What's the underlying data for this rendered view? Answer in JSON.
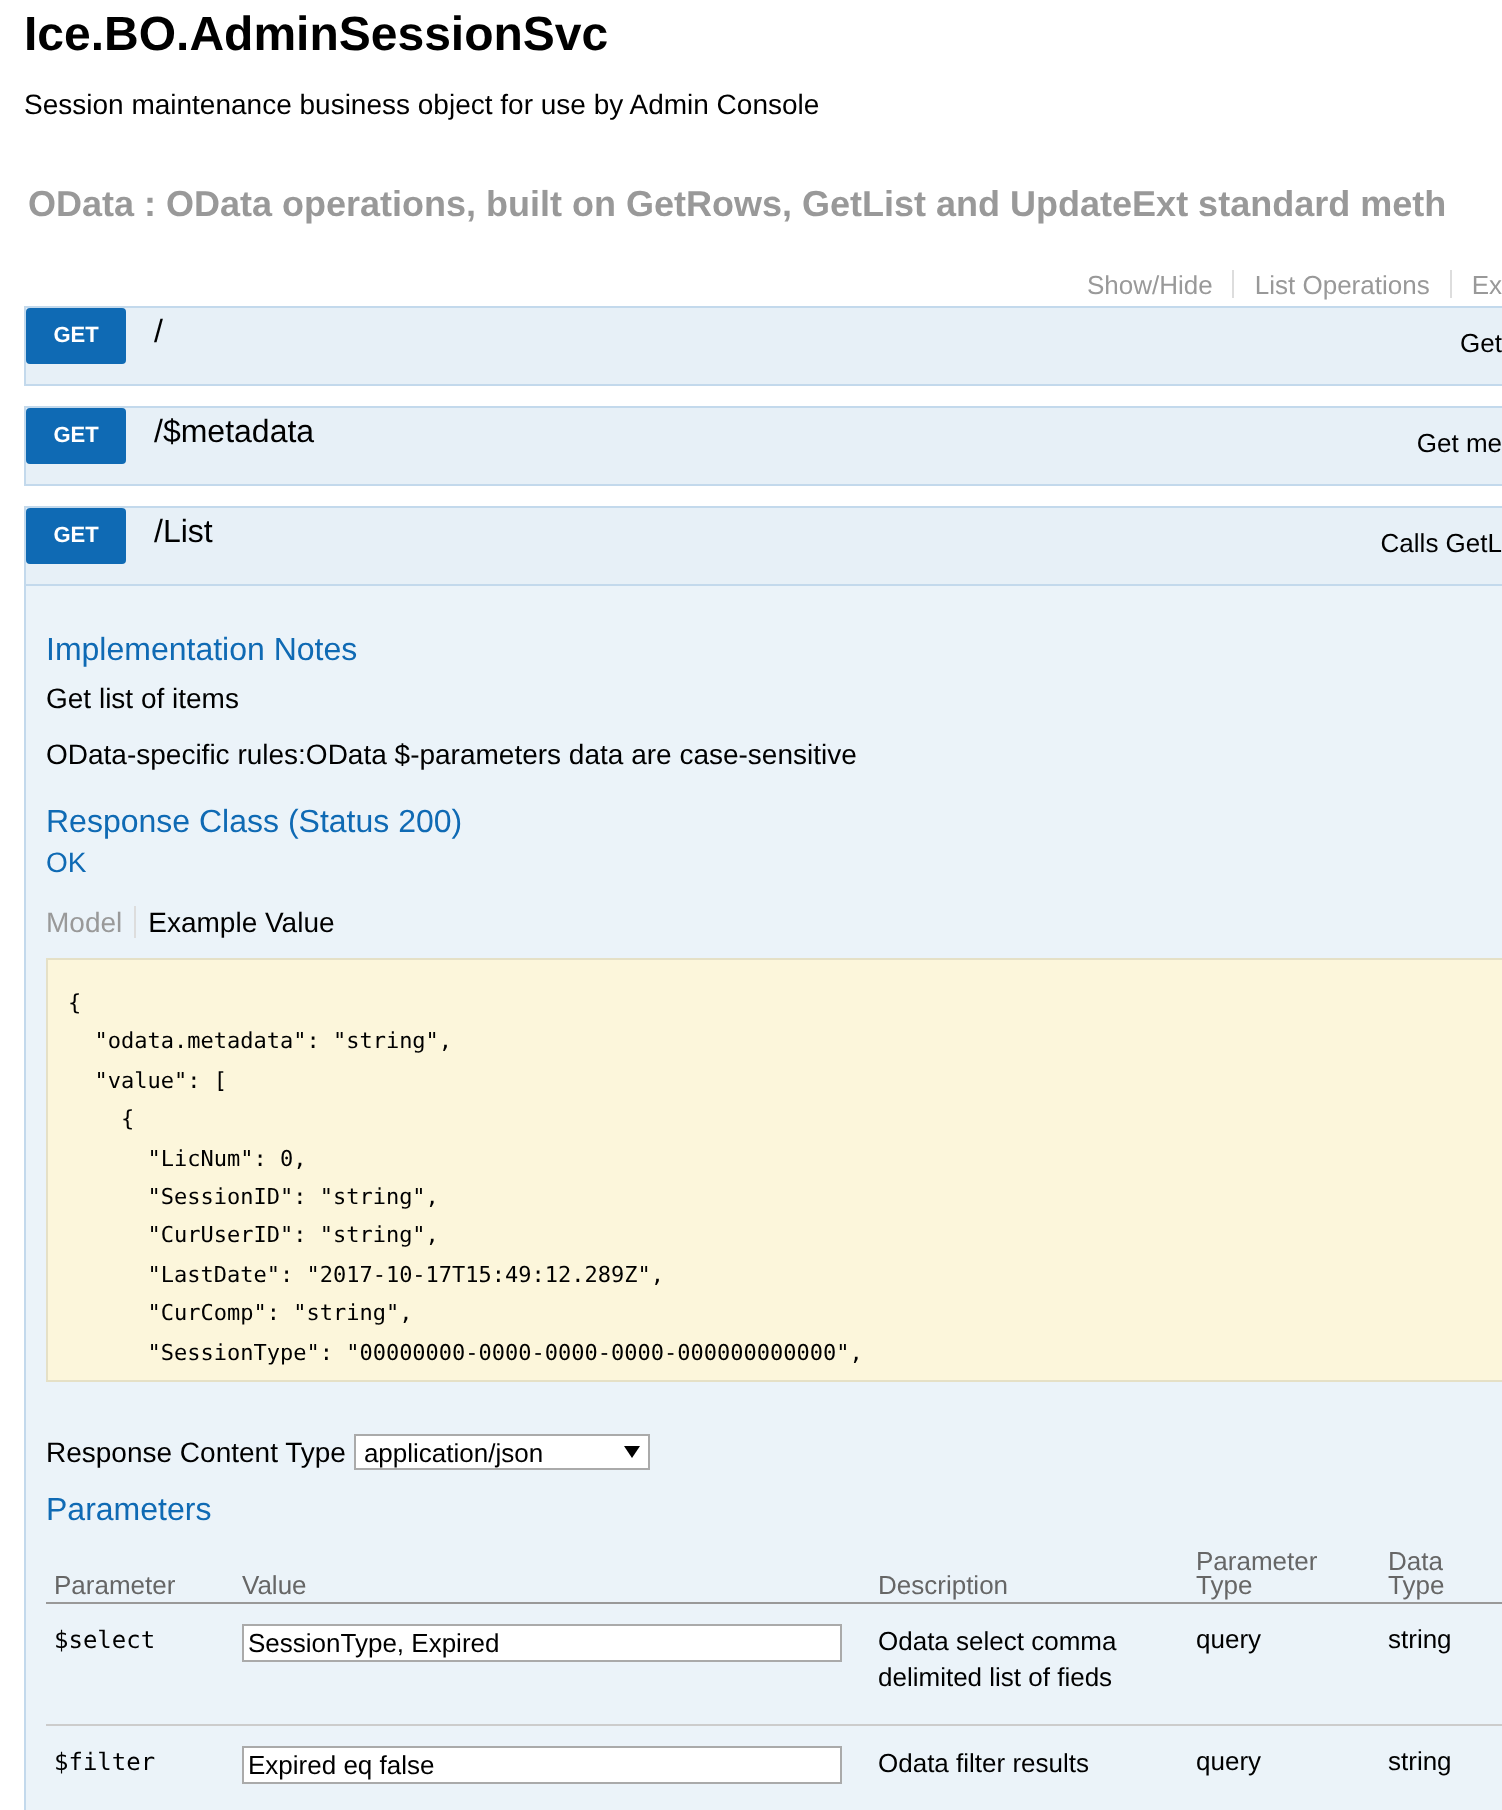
{
  "title": "Ice.BO.AdminSessionSvc",
  "description": "Session maintenance business object for use by Admin Console",
  "section": {
    "heading": "OData : OData operations, built on GetRows, GetList and UpdateExt standard meth",
    "links": [
      "Show/Hide",
      "List Operations",
      "Ex"
    ]
  },
  "operations": [
    {
      "method": "GET",
      "path": "/",
      "summary": "Get",
      "expanded": false
    },
    {
      "method": "GET",
      "path": "/$metadata",
      "summary": "Get me",
      "expanded": false
    },
    {
      "method": "GET",
      "path": "/List",
      "summary": "Calls GetL",
      "expanded": true
    }
  ],
  "details": {
    "implementation_notes_heading": "Implementation Notes",
    "notes": [
      "Get list of items",
      "OData-specific rules:OData $-parameters data are case-sensitive"
    ],
    "response_class_heading": "Response Class (Status 200)",
    "response_status": "OK",
    "model_tabs": [
      {
        "label": "Model",
        "selected": false
      },
      {
        "label": "Example Value",
        "selected": true
      }
    ],
    "example_lines": [
      "{",
      "  \"odata.metadata\": \"string\",",
      "  \"value\": [",
      "    {",
      "      \"LicNum\": 0,",
      "      \"SessionID\": \"string\",",
      "      \"CurUserID\": \"string\",",
      "      \"LastDate\": \"2017-10-17T15:49:12.289Z\",",
      "      \"CurComp\": \"string\",",
      "      \"SessionType\": \"00000000-0000-0000-0000-000000000000\","
    ],
    "content_type_label": "Response Content Type",
    "content_type_value": "application/json",
    "parameters_heading": "Parameters",
    "param_columns": [
      "Parameter",
      "Value",
      "Description",
      "Parameter Type",
      "Data Type"
    ],
    "params": [
      {
        "name": "$select",
        "value": "SessionType, Expired",
        "description": "Odata select comma delimited list of fieds",
        "type": "query",
        "data_type": "string"
      },
      {
        "name": "$filter",
        "value": "Expired eq false",
        "description": "Odata filter results",
        "type": "query",
        "data_type": "string"
      }
    ]
  }
}
